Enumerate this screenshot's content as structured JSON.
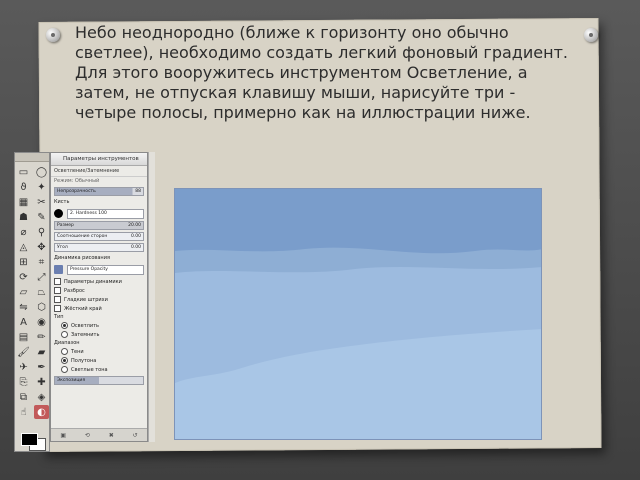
{
  "slide_text": "Небо неоднородно (ближе к горизонту оно обычно светлее), необходимо создать легкий фоновый градиент. Для этого вооружитесь инструментом Осветление, а затем, не отпуская клавишу мыши, нарисуйте три - четыре полосы, примерно как на иллюстрации ниже.",
  "panel": {
    "title": "Параметры инструментов",
    "tool_name": "Осветление/Затемнение",
    "mode_label": "Режим: Обычный",
    "opacity_label": "Непрозрачность",
    "opacity_value": "88",
    "brush_label": "Кисть",
    "brush_name": "2. Hardness 100",
    "size_label": "Размер",
    "size_value": "20.00",
    "aspect_label": "Соотношение сторон",
    "aspect_value": "0.00",
    "angle_label": "Угол",
    "angle_value": "0.00",
    "dynamics_label": "Динамика рисования",
    "dynamics_name": "Pressure Opacity",
    "dynamics_options_label": "Параметры динамики",
    "jitter_label": "Разброс",
    "smooth_label": "Гладкие штрихи",
    "hard_edge_label": "Жёсткий край",
    "type_label": "Тип",
    "dodge_label": "Осветлить",
    "burn_label": "Затемнить",
    "range_label": "Диапазон",
    "shadows_label": "Тени",
    "midtones_label": "Полутона",
    "highlights_label": "Светлые тона",
    "exposure_label": "Экспозиция"
  },
  "colors": {
    "sky_top": "#7a9dcb",
    "sky_mid": "#8eaed4",
    "sky_low": "#9dbbdf",
    "sky_bottom": "#a9c6e6"
  }
}
